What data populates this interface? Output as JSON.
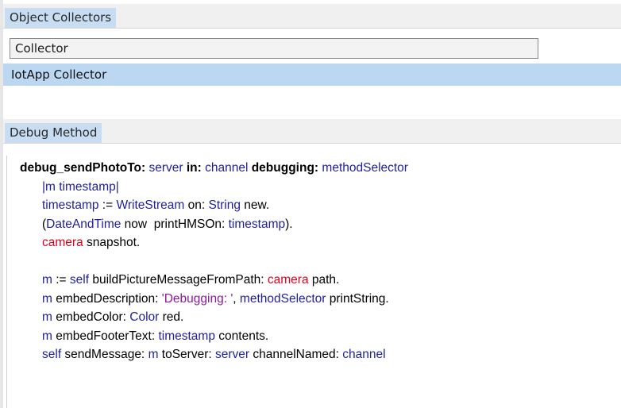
{
  "collectors_pane": {
    "title": "Object Collectors",
    "button_label": "Collector",
    "items": [
      "IotApp Collector"
    ]
  },
  "debug_pane": {
    "title": "Debug Method",
    "code_lines": [
      [
        [
          "kw",
          "debug_sendPhotoTo:"
        ],
        [
          "blk",
          " "
        ],
        [
          "var",
          "server"
        ],
        [
          "blk",
          " "
        ],
        [
          "kw",
          "in:"
        ],
        [
          "blk",
          " "
        ],
        [
          "var",
          "channel"
        ],
        [
          "blk",
          " "
        ],
        [
          "kw",
          "debugging:"
        ],
        [
          "blk",
          " "
        ],
        [
          "var",
          "methodSelector"
        ]
      ],
      [
        [
          "var",
          "|m timestamp|"
        ]
      ],
      [
        [
          "var",
          "timestamp"
        ],
        [
          "blk",
          " := "
        ],
        [
          "cls",
          "WriteStream"
        ],
        [
          "blk",
          " on: "
        ],
        [
          "cls",
          "String"
        ],
        [
          "blk",
          " new."
        ]
      ],
      [
        [
          "blk",
          "("
        ],
        [
          "cls",
          "DateAndTime"
        ],
        [
          "blk",
          " now  printHMSOn: "
        ],
        [
          "var",
          "timestamp"
        ],
        [
          "blk",
          ")."
        ]
      ],
      [
        [
          "inst",
          "camera"
        ],
        [
          "blk",
          " snapshot."
        ]
      ],
      [
        [
          "blk",
          ""
        ]
      ],
      [
        [
          "var",
          "m"
        ],
        [
          "blk",
          " := "
        ],
        [
          "cls",
          "self"
        ],
        [
          "blk",
          " buildPictureMessageFromPath: "
        ],
        [
          "inst",
          "camera"
        ],
        [
          "blk",
          " path."
        ]
      ],
      [
        [
          "var",
          "m"
        ],
        [
          "blk",
          " embedDescription: "
        ],
        [
          "str",
          "'Debugging: '"
        ],
        [
          "blk",
          ", "
        ],
        [
          "var",
          "methodSelector"
        ],
        [
          "blk",
          " printString."
        ]
      ],
      [
        [
          "var",
          "m"
        ],
        [
          "blk",
          " embedColor: "
        ],
        [
          "cls",
          "Color"
        ],
        [
          "blk",
          " red."
        ]
      ],
      [
        [
          "var",
          "m"
        ],
        [
          "blk",
          " embedFooterText: "
        ],
        [
          "var",
          "timestamp"
        ],
        [
          "blk",
          " contents."
        ]
      ],
      [
        [
          "cls",
          "self"
        ],
        [
          "blk",
          " sendMessage: "
        ],
        [
          "var",
          "m"
        ],
        [
          "blk",
          " toServer: "
        ],
        [
          "var",
          "server"
        ],
        [
          "blk",
          " channelNamed: "
        ],
        [
          "var",
          "channel"
        ]
      ]
    ]
  }
}
